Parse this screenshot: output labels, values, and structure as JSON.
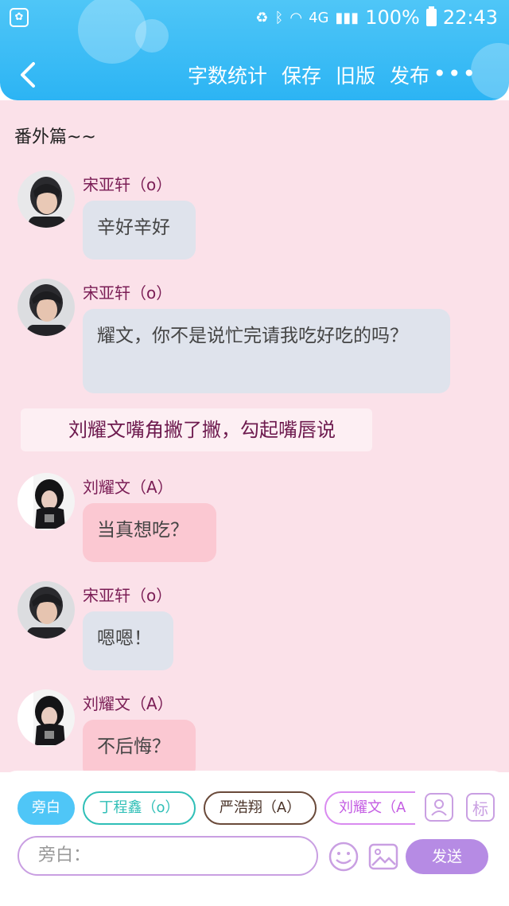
{
  "status_bar": {
    "network": "4G",
    "battery": "100%",
    "time": "22:43"
  },
  "header": {
    "actions": [
      "字数统计",
      "保存",
      "旧版",
      "发布"
    ],
    "more": "•••"
  },
  "chapter_title": "番外篇~~",
  "messages": [
    {
      "sender": "宋亚轩（o）",
      "text": "辛好辛好"
    },
    {
      "sender": "宋亚轩（o）",
      "text": "耀文，你不是说忙完请我吃好吃的吗？"
    },
    {
      "sender": "刘耀文（A）",
      "text": "当真想吃？"
    },
    {
      "sender": "宋亚轩（o）",
      "text": "嗯嗯！"
    },
    {
      "sender": "刘耀文（A）",
      "text": "不后悔？"
    }
  ],
  "narration": "刘耀文嘴角撇了撇，勾起嘴唇说",
  "composer": {
    "chips": [
      "旁白",
      "丁程鑫（o）",
      "严浩翔（A）",
      "刘耀文（A"
    ],
    "role_icon": "角色",
    "tag_icon": "标",
    "placeholder": "旁白：",
    "send_label": "发送"
  },
  "colors": {
    "header": "#2cb4f4",
    "chat_bg": "#fbe1e9",
    "bubble_o": "#dfe3ec",
    "bubble_a": "#fbc8d2",
    "sender_text": "#7a1d55",
    "send_button": "#b68be4"
  }
}
